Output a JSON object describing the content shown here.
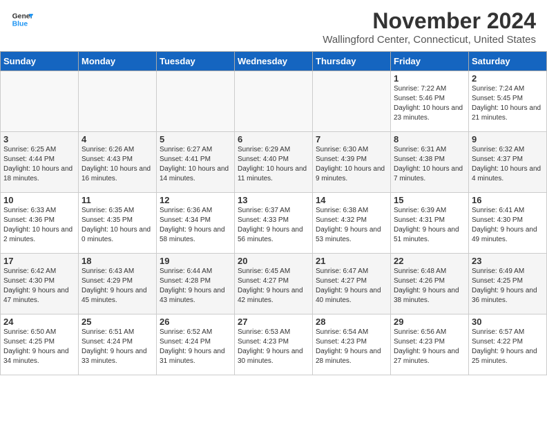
{
  "header": {
    "logo_line1": "General",
    "logo_line2": "Blue",
    "month_title": "November 2024",
    "location": "Wallingford Center, Connecticut, United States"
  },
  "weekdays": [
    "Sunday",
    "Monday",
    "Tuesday",
    "Wednesday",
    "Thursday",
    "Friday",
    "Saturday"
  ],
  "weeks": [
    [
      {
        "day": "",
        "info": ""
      },
      {
        "day": "",
        "info": ""
      },
      {
        "day": "",
        "info": ""
      },
      {
        "day": "",
        "info": ""
      },
      {
        "day": "",
        "info": ""
      },
      {
        "day": "1",
        "info": "Sunrise: 7:22 AM\nSunset: 5:46 PM\nDaylight: 10 hours and 23 minutes."
      },
      {
        "day": "2",
        "info": "Sunrise: 7:24 AM\nSunset: 5:45 PM\nDaylight: 10 hours and 21 minutes."
      }
    ],
    [
      {
        "day": "3",
        "info": "Sunrise: 6:25 AM\nSunset: 4:44 PM\nDaylight: 10 hours and 18 minutes."
      },
      {
        "day": "4",
        "info": "Sunrise: 6:26 AM\nSunset: 4:43 PM\nDaylight: 10 hours and 16 minutes."
      },
      {
        "day": "5",
        "info": "Sunrise: 6:27 AM\nSunset: 4:41 PM\nDaylight: 10 hours and 14 minutes."
      },
      {
        "day": "6",
        "info": "Sunrise: 6:29 AM\nSunset: 4:40 PM\nDaylight: 10 hours and 11 minutes."
      },
      {
        "day": "7",
        "info": "Sunrise: 6:30 AM\nSunset: 4:39 PM\nDaylight: 10 hours and 9 minutes."
      },
      {
        "day": "8",
        "info": "Sunrise: 6:31 AM\nSunset: 4:38 PM\nDaylight: 10 hours and 7 minutes."
      },
      {
        "day": "9",
        "info": "Sunrise: 6:32 AM\nSunset: 4:37 PM\nDaylight: 10 hours and 4 minutes."
      }
    ],
    [
      {
        "day": "10",
        "info": "Sunrise: 6:33 AM\nSunset: 4:36 PM\nDaylight: 10 hours and 2 minutes."
      },
      {
        "day": "11",
        "info": "Sunrise: 6:35 AM\nSunset: 4:35 PM\nDaylight: 10 hours and 0 minutes."
      },
      {
        "day": "12",
        "info": "Sunrise: 6:36 AM\nSunset: 4:34 PM\nDaylight: 9 hours and 58 minutes."
      },
      {
        "day": "13",
        "info": "Sunrise: 6:37 AM\nSunset: 4:33 PM\nDaylight: 9 hours and 56 minutes."
      },
      {
        "day": "14",
        "info": "Sunrise: 6:38 AM\nSunset: 4:32 PM\nDaylight: 9 hours and 53 minutes."
      },
      {
        "day": "15",
        "info": "Sunrise: 6:39 AM\nSunset: 4:31 PM\nDaylight: 9 hours and 51 minutes."
      },
      {
        "day": "16",
        "info": "Sunrise: 6:41 AM\nSunset: 4:30 PM\nDaylight: 9 hours and 49 minutes."
      }
    ],
    [
      {
        "day": "17",
        "info": "Sunrise: 6:42 AM\nSunset: 4:30 PM\nDaylight: 9 hours and 47 minutes."
      },
      {
        "day": "18",
        "info": "Sunrise: 6:43 AM\nSunset: 4:29 PM\nDaylight: 9 hours and 45 minutes."
      },
      {
        "day": "19",
        "info": "Sunrise: 6:44 AM\nSunset: 4:28 PM\nDaylight: 9 hours and 43 minutes."
      },
      {
        "day": "20",
        "info": "Sunrise: 6:45 AM\nSunset: 4:27 PM\nDaylight: 9 hours and 42 minutes."
      },
      {
        "day": "21",
        "info": "Sunrise: 6:47 AM\nSunset: 4:27 PM\nDaylight: 9 hours and 40 minutes."
      },
      {
        "day": "22",
        "info": "Sunrise: 6:48 AM\nSunset: 4:26 PM\nDaylight: 9 hours and 38 minutes."
      },
      {
        "day": "23",
        "info": "Sunrise: 6:49 AM\nSunset: 4:25 PM\nDaylight: 9 hours and 36 minutes."
      }
    ],
    [
      {
        "day": "24",
        "info": "Sunrise: 6:50 AM\nSunset: 4:25 PM\nDaylight: 9 hours and 34 minutes."
      },
      {
        "day": "25",
        "info": "Sunrise: 6:51 AM\nSunset: 4:24 PM\nDaylight: 9 hours and 33 minutes."
      },
      {
        "day": "26",
        "info": "Sunrise: 6:52 AM\nSunset: 4:24 PM\nDaylight: 9 hours and 31 minutes."
      },
      {
        "day": "27",
        "info": "Sunrise: 6:53 AM\nSunset: 4:23 PM\nDaylight: 9 hours and 30 minutes."
      },
      {
        "day": "28",
        "info": "Sunrise: 6:54 AM\nSunset: 4:23 PM\nDaylight: 9 hours and 28 minutes."
      },
      {
        "day": "29",
        "info": "Sunrise: 6:56 AM\nSunset: 4:23 PM\nDaylight: 9 hours and 27 minutes."
      },
      {
        "day": "30",
        "info": "Sunrise: 6:57 AM\nSunset: 4:22 PM\nDaylight: 9 hours and 25 minutes."
      }
    ]
  ]
}
